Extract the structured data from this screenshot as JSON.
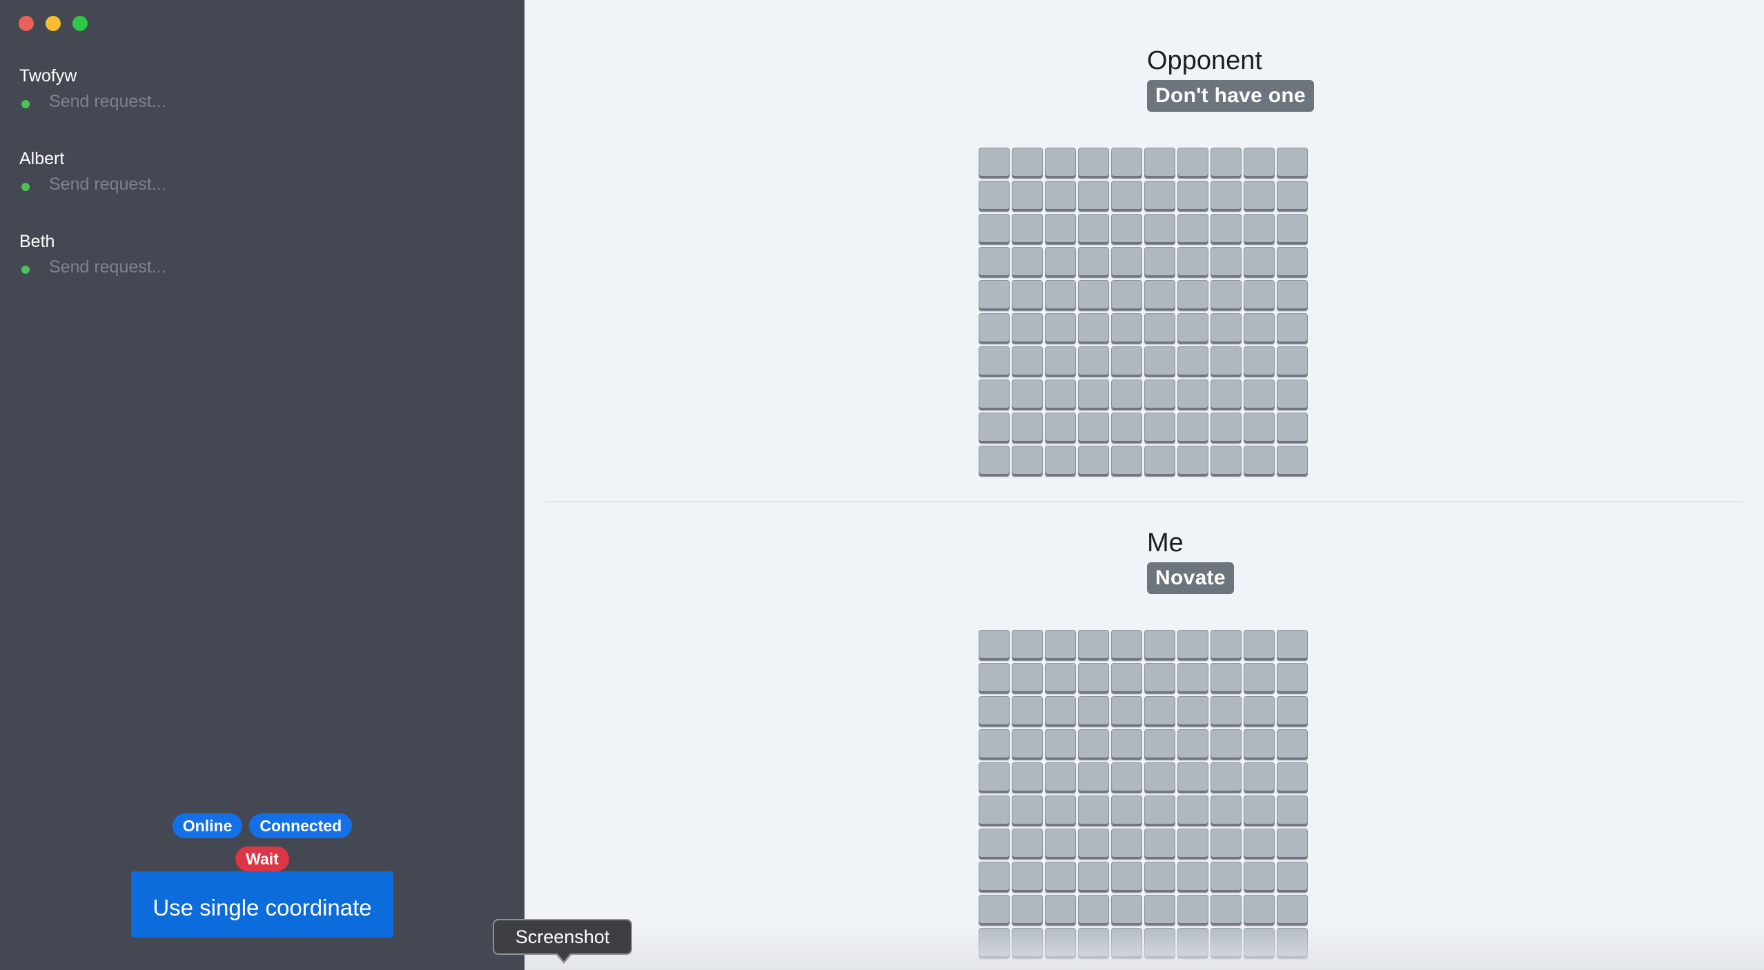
{
  "window": {
    "controls": [
      "close",
      "minimize",
      "maximize"
    ]
  },
  "sidebar": {
    "contacts": [
      {
        "name": "Twofyw",
        "placeholder": "Send request...",
        "status": "online"
      },
      {
        "name": "Albert",
        "placeholder": "Send request...",
        "status": "online"
      },
      {
        "name": "Beth",
        "placeholder": "Send request...",
        "status": "online"
      }
    ],
    "status_badges": {
      "online": "Online",
      "connected": "Connected",
      "wait": "Wait"
    },
    "action_button": "Use single coordinate"
  },
  "opponent": {
    "title": "Opponent",
    "badge": "Don't have one",
    "grid": {
      "rows": 10,
      "cols": 10
    }
  },
  "me": {
    "title": "Me",
    "badge": "Novate",
    "grid": {
      "rows": 10,
      "cols": 10
    }
  },
  "tooltip": {
    "text": "Screenshot"
  },
  "colors": {
    "sidebar_bg": "#434852",
    "main_bg": "#f0f3f8",
    "primary": "#0d6cdc",
    "badge_blue": "#1470e8",
    "badge_red": "#dc3545",
    "badge_gray": "#6c757d",
    "cell": "#b0b8bf",
    "online": "#4cc15b"
  }
}
